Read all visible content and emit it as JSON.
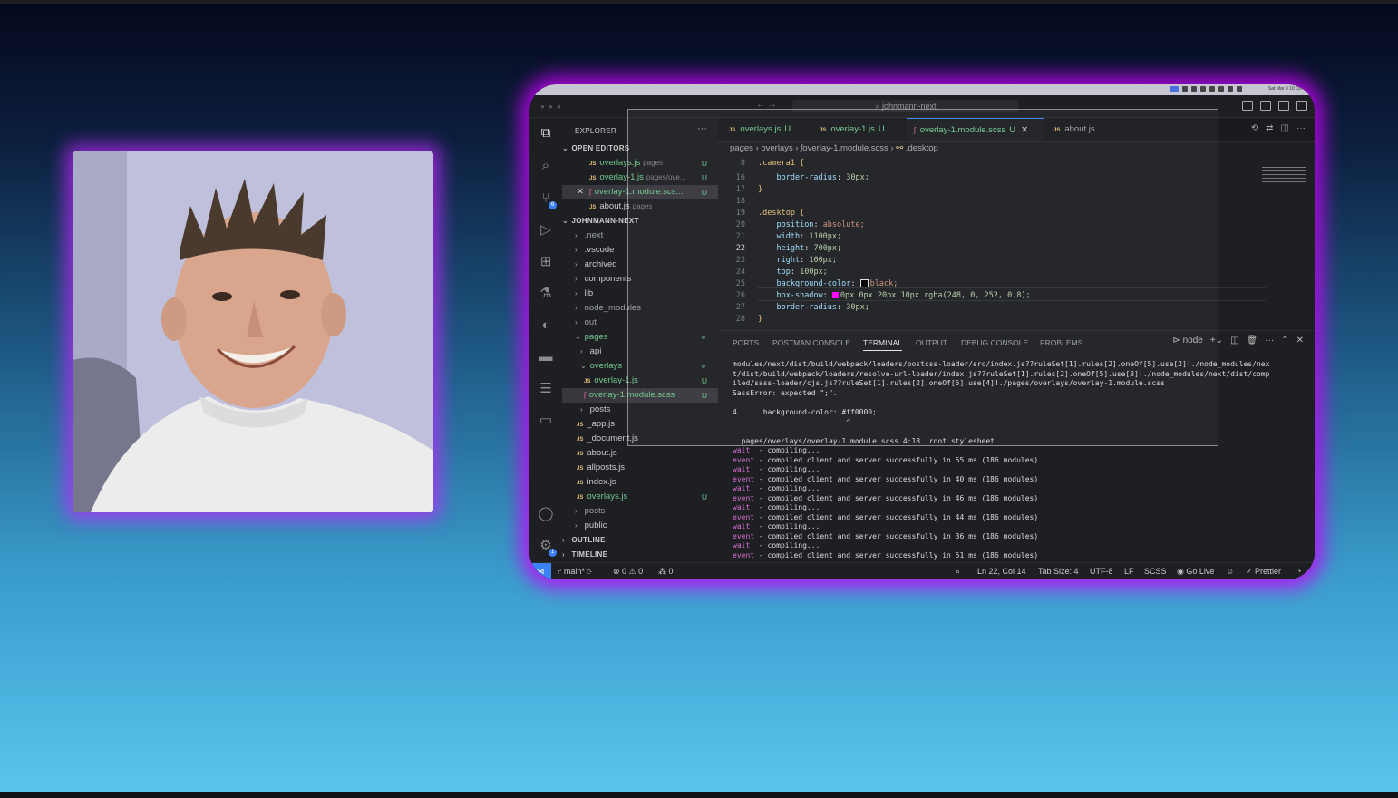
{
  "menubar": {
    "apple": "",
    "clock": "Sat Mar 9 10:03PM"
  },
  "window": {
    "search": "johnmann-next"
  },
  "explorer": {
    "title": "EXPLORER",
    "open_editors_header": "OPEN EDITORS",
    "open_editors": [
      {
        "name": "overlays.js",
        "hint": "pages",
        "badge": "U"
      },
      {
        "name": "overlay-1.js",
        "hint": "pages/ove...",
        "badge": "U"
      },
      {
        "name": "overlay-1.module.scs...",
        "badge": "U"
      },
      {
        "name": "about.js",
        "hint": "pages"
      }
    ],
    "project_header": "JOHNMANN-NEXT",
    "tree": [
      ".next",
      ".vscode",
      "archived",
      "components",
      "lib",
      "node_modules",
      "out",
      "pages",
      "api",
      "overlays",
      "overlay-1.js",
      "overlay-1.module.scss",
      "posts",
      "_app.js",
      "_document.js",
      "about.js",
      "allposts.js",
      "index.js",
      "overlays.js",
      "posts",
      "public"
    ],
    "badge_u": "U",
    "outline": "OUTLINE",
    "timeline": "TIMELINE"
  },
  "tabs": [
    {
      "label": "overlays.js",
      "badge": "U"
    },
    {
      "label": "overlay-1.js",
      "badge": "U"
    },
    {
      "label": "overlay-1.module.scss",
      "badge": "U"
    },
    {
      "label": "about.js"
    }
  ],
  "breadcrumb": {
    "a": "pages",
    "b": "overlays",
    "c": "overlay-1.module.scss",
    "d": ".desktop"
  },
  "code": {
    "sticky": {
      "ln": "8",
      "text": ".camera1 {"
    },
    "lines": [
      {
        "ln": "16",
        "sel": "",
        "prop": "border-radius",
        "val": "30px;"
      },
      {
        "ln": "17",
        "brace": "}"
      },
      {
        "ln": "18"
      },
      {
        "ln": "19",
        "selector": ".desktop {"
      },
      {
        "ln": "20",
        "prop": "position",
        "val": "absolute;"
      },
      {
        "ln": "21",
        "prop": "width",
        "val": "1100px;"
      },
      {
        "ln": "22",
        "prop": "height",
        "val": "700px;"
      },
      {
        "ln": "23",
        "prop": "right",
        "val": "100px;"
      },
      {
        "ln": "24",
        "prop": "top",
        "val": "100px;"
      },
      {
        "ln": "25",
        "prop": "background-color",
        "val": "black;"
      },
      {
        "ln": "26",
        "prop": "box-shadow",
        "val": "0px 0px 20px 10px rgba(248, 0, 252, 0.8);"
      },
      {
        "ln": "27",
        "prop": "border-radius",
        "val": "30px;"
      },
      {
        "ln": "28",
        "brace": "}"
      }
    ]
  },
  "panel": {
    "tabs": [
      "PORTS",
      "POSTMAN CONSOLE",
      "TERMINAL",
      "OUTPUT",
      "DEBUG CONSOLE",
      "PROBLEMS"
    ],
    "shell": "node",
    "terminal": [
      "modules/next/dist/build/webpack/loaders/postcss-loader/src/index.js??ruleSet[1].rules[2].oneOf[5].use[2]!./node_modules/nex",
      "t/dist/build/webpack/loaders/resolve-url-loader/index.js??ruleSet[1].rules[2].oneOf[5].use[3]!./node_modules/next/dist/comp",
      "iled/sass-loader/cjs.js??ruleSet[1].rules[2].oneOf[5].use[4]!./pages/overlays/overlay-1.module.scss",
      "SassError: expected \";\".",
      "",
      "4      background-color: #ff0000;",
      "                          ^",
      "",
      "  pages/overlays/overlay-1.module.scss 4:18  root stylesheet"
    ],
    "log": [
      {
        "tag": "wait ",
        "msg": " - compiling..."
      },
      {
        "tag": "event",
        "msg": " - compiled client and server successfully in 55 ms (186 modules)"
      },
      {
        "tag": "wait ",
        "msg": " - compiling..."
      },
      {
        "tag": "event",
        "msg": " - compiled client and server successfully in 40 ms (186 modules)"
      },
      {
        "tag": "wait ",
        "msg": " - compiling..."
      },
      {
        "tag": "event",
        "msg": " - compiled client and server successfully in 46 ms (186 modules)"
      },
      {
        "tag": "wait ",
        "msg": " - compiling..."
      },
      {
        "tag": "event",
        "msg": " - compiled client and server successfully in 44 ms (186 modules)"
      },
      {
        "tag": "wait ",
        "msg": " - compiling..."
      },
      {
        "tag": "event",
        "msg": " - compiled client and server successfully in 36 ms (186 modules)"
      },
      {
        "tag": "wait ",
        "msg": " - compiling..."
      },
      {
        "tag": "event",
        "msg": " - compiled client and server successfully in 51 ms (186 modules)"
      }
    ]
  },
  "status": {
    "branch": "main*",
    "problems": "⊗ 0 ⚠ 0",
    "ports": "0",
    "position": "Ln 22, Col 14",
    "tabsize": "Tab Size: 4",
    "encoding": "UTF-8",
    "eol": "LF",
    "language": "SCSS",
    "golive": "Go Live",
    "prettier": "Prettier"
  },
  "colors": {
    "glow": "#c800fc",
    "accent": "#3b82f6",
    "untracked": "#73c991"
  }
}
